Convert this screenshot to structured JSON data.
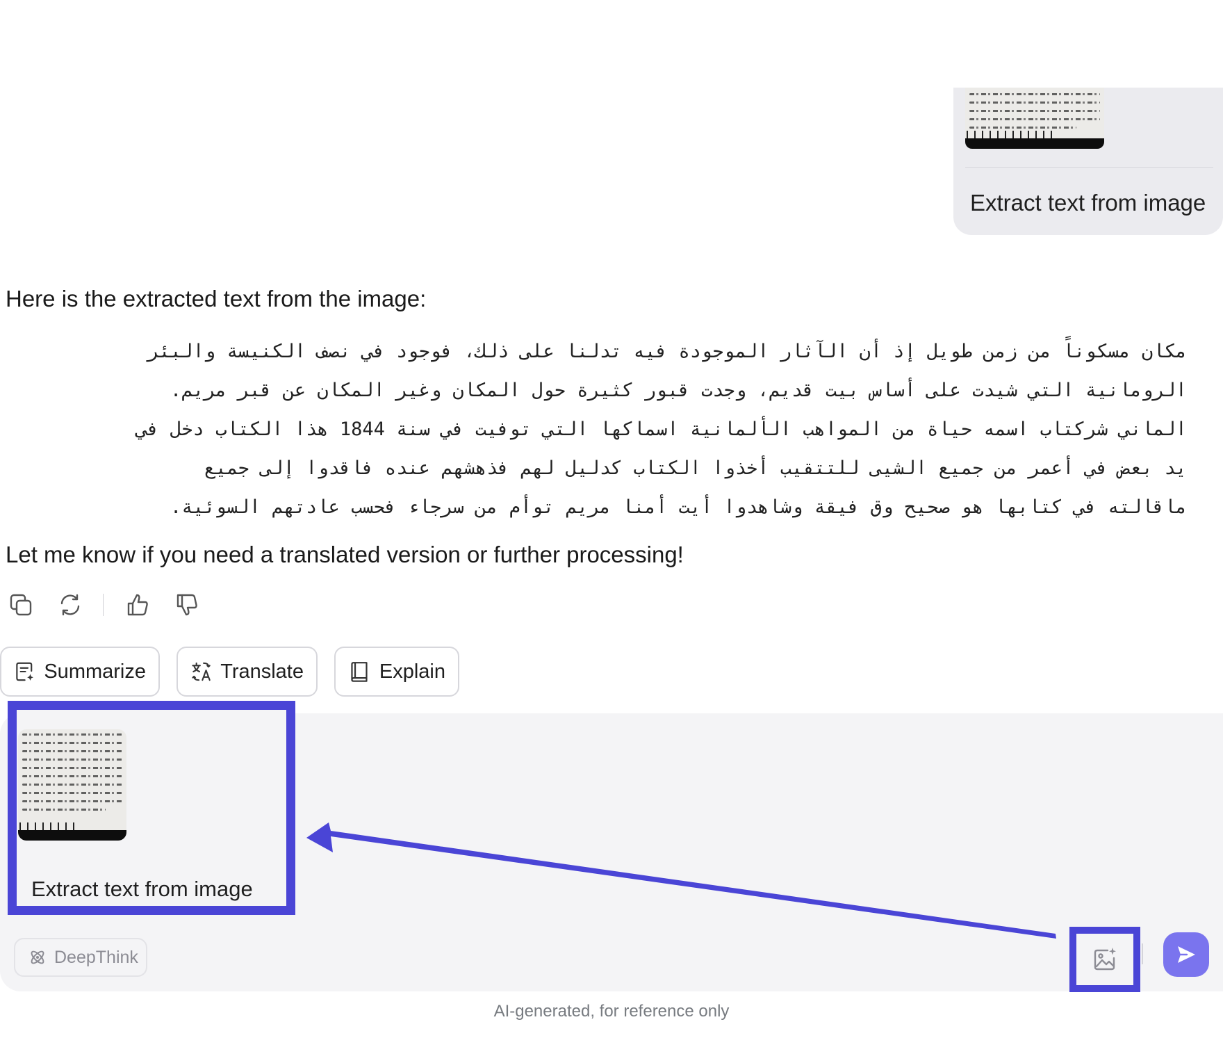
{
  "user_message": {
    "text": "Extract text from image",
    "attachment_icon": "manuscript-image-thumbnail"
  },
  "response": {
    "intro": "Here is the extracted text from the image:",
    "arabic_lines": [
      "مكان مسكوناً من زمن طويل إذ أن الآثار الموجودة فيه تدلنا على ذلك، فوجود في نصف الكنيسة والبئر",
      "الرومانية التي شيدت على أساس بيت قديم، وجدت قبور كثيرة حول المكان وغير المكان عن قبر مريم.",
      "الماني شركتاب اسمه حياة من المواهب الألمانية اسماكها التي توفيت في سنة 1844 هذا الكتاب دخل في",
      "يد بعض في أعمر من جميع الشيى للتتقيب أخذوا الكتاب كدليل لهم فذهشهم عنده فاقدوا إلى جميع",
      "ماقالته في كتابها هو صحيح وق فيقة وشاهدوا أيت أمنا مريم توأم من سرجاء فحسب عادتهم السوئية."
    ],
    "outro": "Let me know if you need a translated version or further processing!"
  },
  "feedback_icons": [
    "copy-icon",
    "regenerate-icon",
    "thumbs-up-icon",
    "thumbs-down-icon"
  ],
  "quick_actions": [
    {
      "label": "Summarize",
      "icon": "summarize-icon"
    },
    {
      "label": "Translate",
      "icon": "translate-icon"
    },
    {
      "label": "Explain",
      "icon": "book-icon"
    }
  ],
  "composer": {
    "attachment_label": "Extract text from image",
    "deepthink_label": "DeepThink",
    "upload_icon": "image-upload-icon",
    "send_icon": "send-icon"
  },
  "footer": {
    "note": "AI-generated, for reference only"
  },
  "colors": {
    "highlight": "#4a45d6",
    "send_button": "#7a74ee",
    "panel_bg": "#f4f4f6",
    "bubble_bg": "#ebebef"
  }
}
